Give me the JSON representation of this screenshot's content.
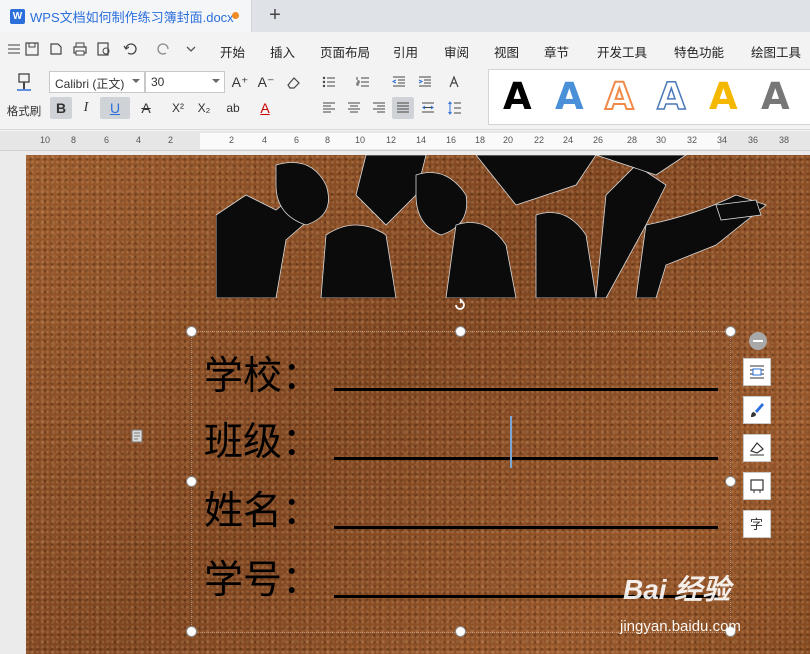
{
  "app": {
    "logo_letter": "W",
    "document_title": "WPS文档如何制作练习簿封面.docx",
    "new_tab_label": "+"
  },
  "menu": {
    "items": [
      "开始",
      "插入",
      "页面布局",
      "引用",
      "审阅",
      "视图",
      "章节",
      "开发工具",
      "特色功能",
      "绘图工具"
    ]
  },
  "ribbon": {
    "format_painter_label": "格式刷",
    "font_name": "Calibri (正文)",
    "font_size": "30",
    "buttons": {
      "bold": "B",
      "italic": "I",
      "underline": "U",
      "strikethrough": "A",
      "superscript": "X²",
      "subscript": "X₂",
      "highlight": "ab",
      "font_color": "A",
      "grow_font": "A⁺",
      "shrink_font": "A⁻"
    },
    "text_styles": {
      "letter": "A",
      "colors": [
        "#000000",
        "#4a90d9",
        "#f08a4b",
        "#ffffff",
        "#f5b800",
        "#777777"
      ]
    }
  },
  "ruler": {
    "ticks": [
      "10",
      "8",
      "6",
      "4",
      "2",
      "2",
      "4",
      "6",
      "8",
      "10",
      "12",
      "14",
      "16",
      "18",
      "20",
      "22",
      "24",
      "26",
      "28",
      "30",
      "32",
      "34",
      "36",
      "38"
    ]
  },
  "document": {
    "fields": [
      {
        "label": "学校："
      },
      {
        "label": "班级："
      },
      {
        "label": "姓名："
      },
      {
        "label": "学号："
      }
    ],
    "background_color": "#8b4f25"
  },
  "watermark": {
    "logo": "Bai 经验",
    "url": "jingyan.baidu.com"
  }
}
